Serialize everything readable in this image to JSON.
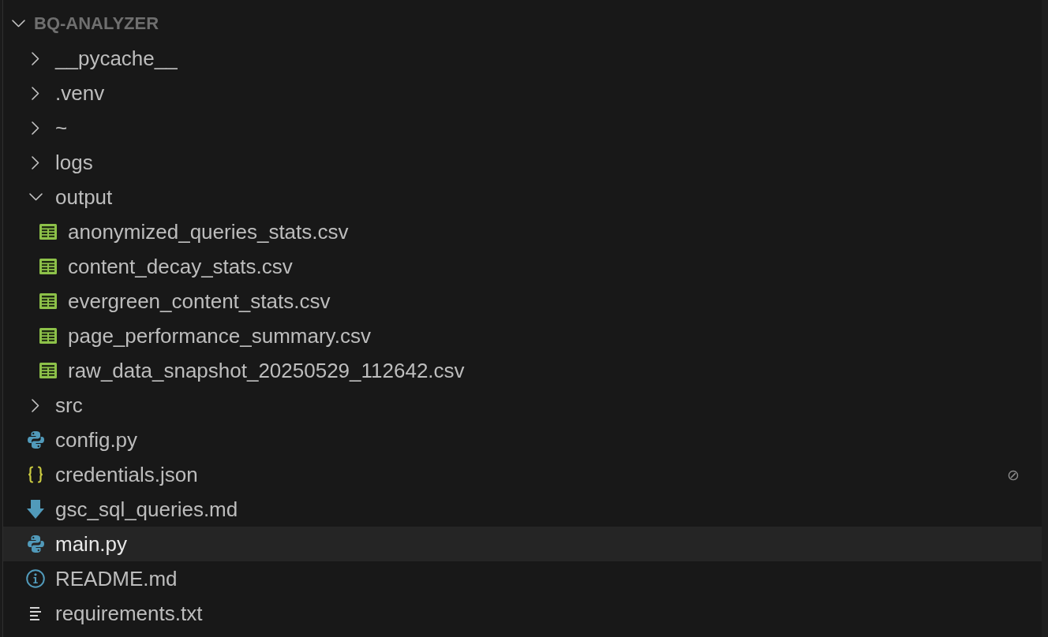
{
  "explorer": {
    "root": {
      "label": "BQ-ANALYZER",
      "expanded": true,
      "children": [
        {
          "kind": "folder",
          "label": "__pycache__",
          "expanded": false,
          "selected": false
        },
        {
          "kind": "folder",
          "label": ".venv",
          "expanded": false,
          "selected": false
        },
        {
          "kind": "folder",
          "label": "~",
          "expanded": false,
          "selected": false
        },
        {
          "kind": "folder",
          "label": "logs",
          "expanded": false,
          "selected": false
        },
        {
          "kind": "folder",
          "label": "output",
          "expanded": true,
          "selected": false,
          "children": [
            {
              "kind": "spreadsheet",
              "label": "anonymized_queries_stats.csv",
              "selected": false
            },
            {
              "kind": "spreadsheet",
              "label": "content_decay_stats.csv",
              "selected": false
            },
            {
              "kind": "spreadsheet",
              "label": "evergreen_content_stats.csv",
              "selected": false
            },
            {
              "kind": "spreadsheet",
              "label": "page_performance_summary.csv",
              "selected": false
            },
            {
              "kind": "spreadsheet",
              "label": "raw_data_snapshot_20250529_112642.csv",
              "selected": false
            }
          ]
        },
        {
          "kind": "folder",
          "label": "src",
          "expanded": false,
          "selected": false
        },
        {
          "kind": "python",
          "label": "config.py",
          "selected": false
        },
        {
          "kind": "json",
          "label": "credentials.json",
          "selected": false,
          "decoration": "⊘"
        },
        {
          "kind": "markdown",
          "label": "gsc_sql_queries.md",
          "selected": false
        },
        {
          "kind": "python",
          "label": "main.py",
          "selected": true
        },
        {
          "kind": "info",
          "label": "README.md",
          "selected": false
        },
        {
          "kind": "text",
          "label": "requirements.txt",
          "selected": false
        }
      ]
    }
  }
}
